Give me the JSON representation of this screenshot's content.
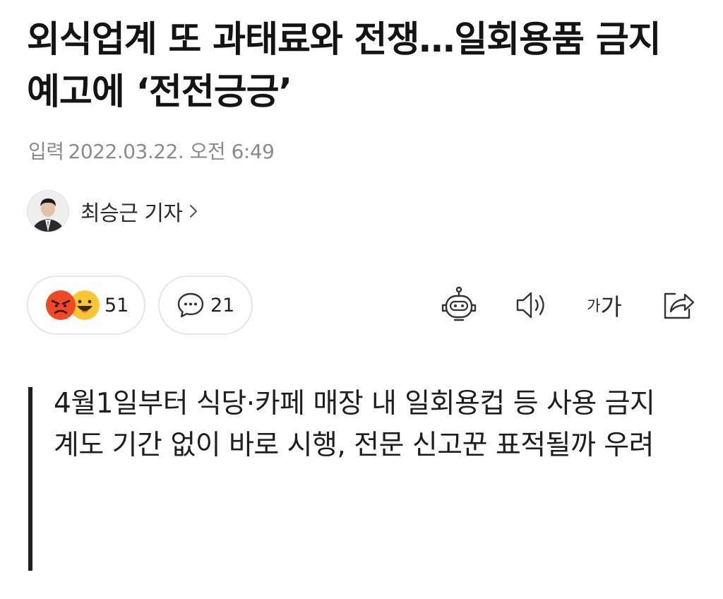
{
  "article": {
    "title": "외식업계 또 과태료와 전쟁…일회용품 금지 예고에 ‘전전긍긍’",
    "date_label": "입력",
    "date_value": "2022.03.22. 오전 6:49"
  },
  "reporter": {
    "name": "최승근 기자",
    "avatar_icon": "reporter-photo",
    "chevron_icon": "chevron-right-icon"
  },
  "reactions": {
    "count": "51",
    "icons": [
      "angry-face-icon",
      "laughing-face-icon"
    ]
  },
  "comments": {
    "count": "21",
    "icon": "speech-bubble-icon"
  },
  "toolbar": {
    "summary_bot_icon": "robot-icon",
    "tts_icon": "speaker-icon",
    "font_small": "가",
    "font_big": "가",
    "share_icon": "share-icon"
  },
  "summary": {
    "line1": "4월1일부터 식당·카페 매장 내 일회용컵 등 사용 금지",
    "line2": "계도 기간 없이 바로 시행, 전문 신고꾼 표적될까 우려"
  },
  "colors": {
    "text": "#1e1e1e",
    "muted": "#8a8a8a",
    "border": "#e6e6e6",
    "angry": "#ef4a23",
    "happy": "#f7c631"
  }
}
